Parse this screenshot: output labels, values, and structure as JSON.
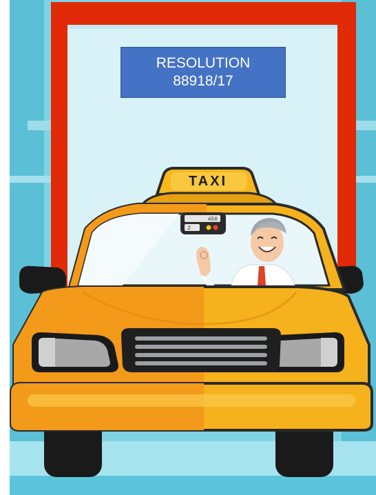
{
  "scene": {
    "sign": {
      "line1": "RESOLUTION",
      "line2": "88918/17"
    },
    "roof_sign": "TAXI",
    "meter": {
      "fare": "450",
      "digit": "2"
    },
    "colors": {
      "frame_red": "#e12a07",
      "door_light": "#d8f2f7",
      "wall_teal": "#5cc5dc",
      "taxi_yellow": "#f6b21c",
      "taxi_orange": "#f39a1a",
      "label_blue": "#4472c4"
    }
  }
}
